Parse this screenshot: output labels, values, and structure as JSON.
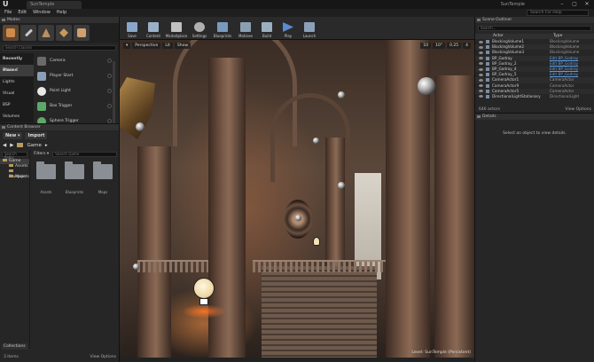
{
  "titlebar": {
    "doc_tab": "SunTemple",
    "project": "SunTemple",
    "min": "–",
    "max": "▢",
    "close": "✕"
  },
  "menu": [
    "File",
    "Edit",
    "Window",
    "Help"
  ],
  "search_help": {
    "placeholder": "Search For Help"
  },
  "modes": {
    "tab_label": "Modes",
    "search_placeholder": "Search Classes",
    "categories": [
      "Recently Placed",
      "Basic",
      "Lights",
      "Visual",
      "BSP",
      "Volumes",
      "All Classes"
    ],
    "selected_category": "Basic",
    "items": [
      {
        "label": "Camera",
        "icon": "camera-icon",
        "color": "#6a6a6a"
      },
      {
        "label": "Player Start",
        "icon": "player-start-icon",
        "color": "#8aa0b8"
      },
      {
        "label": "Point Light",
        "icon": "point-light-icon",
        "color": "#e8e8e8"
      },
      {
        "label": "Box Trigger",
        "icon": "box-trigger-icon",
        "color": "#5ea868"
      },
      {
        "label": "Sphere Trigger",
        "icon": "sphere-trigger-icon",
        "color": "#5ea868"
      }
    ]
  },
  "content_browser": {
    "tab_label": "Content Browser",
    "new_label": "New",
    "import_label": "Import",
    "path": "Game",
    "search_paths_placeholder": "Search Paths",
    "tree": [
      "Game",
      "Assets",
      "Blueprints",
      "Maps"
    ],
    "filters_label": "Filters",
    "search_game_placeholder": "Search Game",
    "folders": [
      "Assets",
      "Blueprints",
      "Maps"
    ],
    "collections_label": "Collections",
    "item_count": "3 items",
    "view_options": "View Options"
  },
  "toolbar": {
    "buttons": [
      {
        "label": "Save",
        "color": "#8aa6c8"
      },
      {
        "label": "Content",
        "color": "#9ab0c8"
      },
      {
        "label": "Marketplace",
        "color": "#c0c0c0"
      },
      {
        "label": "Settings",
        "color": "#b0b0b0"
      },
      {
        "label": "Blueprints",
        "color": "#7a9ac0"
      },
      {
        "label": "Matinee",
        "color": "#8aa0b0"
      },
      {
        "label": "Build",
        "color": "#9ab0c0"
      },
      {
        "label": "Play",
        "color": "#5a8ad0"
      },
      {
        "label": "Launch",
        "color": "#8aa0b8"
      }
    ]
  },
  "viewport": {
    "mode_buttons": [
      "Perspective",
      "Lit",
      "Show"
    ],
    "right_buttons": [
      "10",
      "10°",
      "0.25",
      "4"
    ],
    "level_label": "Level:  SunTemple (Persistent)"
  },
  "outliner": {
    "tab_label": "Scene Outliner",
    "search_placeholder": "Search...",
    "col_actor": "Actor",
    "col_type": "Type",
    "rows": [
      {
        "actor": "BlockingVolume1",
        "type": "BlockingVolume",
        "link": false
      },
      {
        "actor": "BlockingVolume2",
        "type": "BlockingVolume",
        "link": false
      },
      {
        "actor": "BlockingVolume3",
        "type": "BlockingVolume",
        "link": false
      },
      {
        "actor": "BP_Godray",
        "type": "Edit BP_Godray",
        "link": true
      },
      {
        "actor": "BP_Godray_2",
        "type": "Edit BP_Godray",
        "link": true
      },
      {
        "actor": "BP_Godray_4",
        "type": "Edit BP_Godray",
        "link": true
      },
      {
        "actor": "BP_Godray_5",
        "type": "Edit BP_Godray",
        "link": true
      },
      {
        "actor": "CameraActor1",
        "type": "CameraActor",
        "link": false
      },
      {
        "actor": "CameraActor9",
        "type": "CameraActor",
        "link": false
      },
      {
        "actor": "CameraActor5",
        "type": "CameraActor",
        "link": false
      },
      {
        "actor": "DirectionalLightStationary",
        "type": "DirectionalLight",
        "link": false
      }
    ],
    "count": "646 actors",
    "view_options": "View Options"
  },
  "details": {
    "tab_label": "Details",
    "empty_message": "Select an object to view details."
  }
}
